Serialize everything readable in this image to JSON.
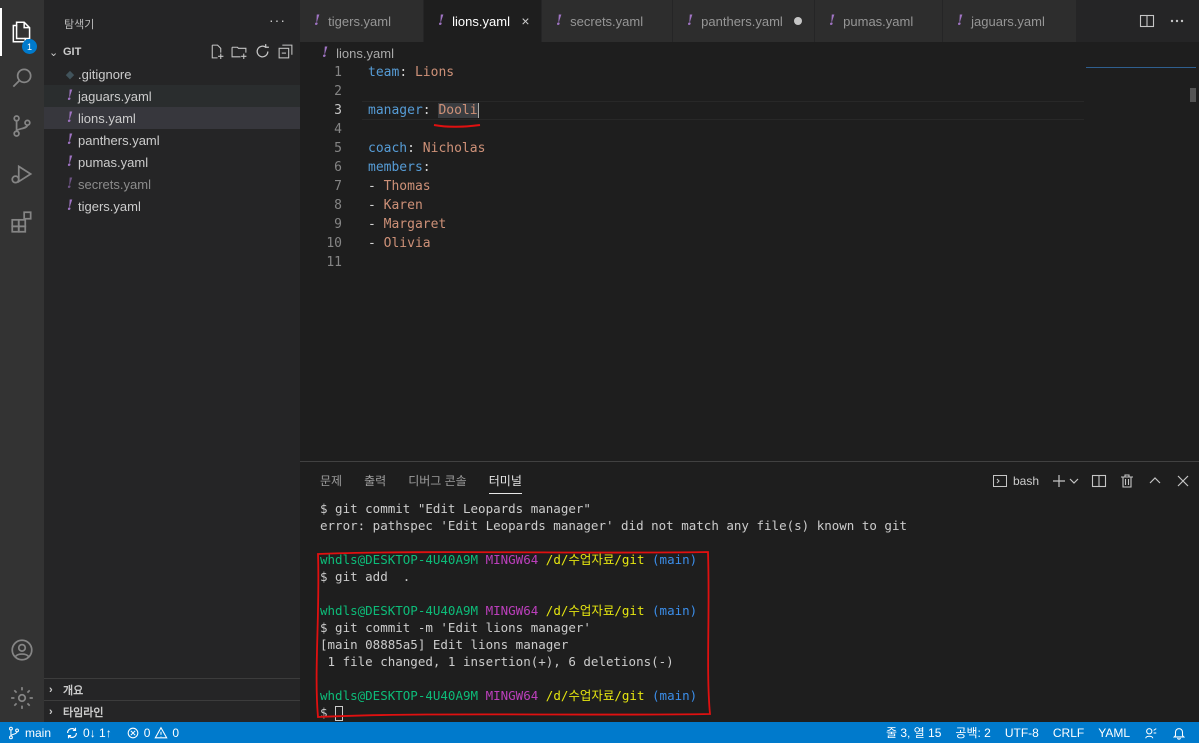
{
  "explorer": {
    "title": "탐색기",
    "more": "···",
    "section": "GIT",
    "files": [
      {
        "name": ".gitignore",
        "type": "git"
      },
      {
        "name": "jaguars.yaml",
        "type": "yaml"
      },
      {
        "name": "lions.yaml",
        "type": "yaml"
      },
      {
        "name": "panthers.yaml",
        "type": "yaml"
      },
      {
        "name": "pumas.yaml",
        "type": "yaml"
      },
      {
        "name": "secrets.yaml",
        "type": "yaml"
      },
      {
        "name": "tigers.yaml",
        "type": "yaml"
      }
    ],
    "outline": "개요",
    "timeline": "타임라인"
  },
  "activity": {
    "badge": "1"
  },
  "tabs": [
    {
      "label": "tigers.yaml"
    },
    {
      "label": "lions.yaml"
    },
    {
      "label": "secrets.yaml"
    },
    {
      "label": "panthers.yaml"
    },
    {
      "label": "pumas.yaml"
    },
    {
      "label": "jaguars.yaml"
    }
  ],
  "yaml_mark": "!",
  "close_glyph": "×",
  "breadcrumb": "lions.yaml",
  "editor": {
    "line_numbers": [
      "1",
      "2",
      "3",
      "4",
      "5",
      "6",
      "7",
      "8",
      "9",
      "10",
      "11"
    ],
    "l1_key": "team",
    "l1_val": "Lions",
    "l3_key": "manager",
    "l3_val": "Dooli",
    "l5_key": "coach",
    "l5_val": "Nicholas",
    "l6_key": "members",
    "colon": ":",
    "dash": "-",
    "members": [
      "Thomas",
      "Karen",
      "Margaret",
      "Olivia"
    ]
  },
  "panel": {
    "tabs": [
      "문제",
      "출력",
      "디버그 콘솔",
      "터미널"
    ],
    "shell": "bash"
  },
  "terminal": {
    "l1": "$ git commit \"Edit Leopards manager\"",
    "l2": "error: pathspec 'Edit Leopards manager' did not match any file(s) known to git",
    "user": "whdls@DESKTOP-4U40A9M",
    "env": "MINGW64",
    "path": "/d/수업자료/git",
    "branch": "(main)",
    "cmd1": "$ git add  .",
    "cmd2": "$ git commit -m 'Edit lions manager'",
    "out1": "[main 08885a5] Edit lions manager",
    "out2": " 1 file changed, 1 insertion(+), 6 deletions(-)",
    "prompt": "$ "
  },
  "statusbar": {
    "branch": "main",
    "sync": "0↓ 1↑",
    "errors": "0",
    "warnings": "0",
    "position": "줄 3, 열 15",
    "spaces": "공백: 2",
    "encoding": "UTF-8",
    "eol": "CRLF",
    "language": "YAML"
  },
  "colors": {
    "accent": "#007acc",
    "annotation": "#e01010"
  }
}
